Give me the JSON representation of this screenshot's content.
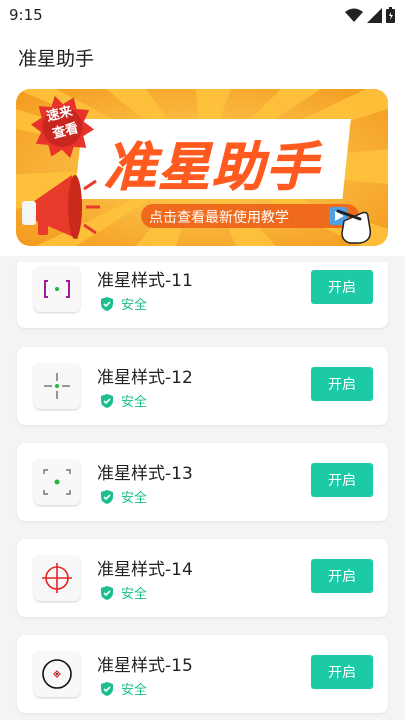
{
  "status_bar": {
    "time": "9:15",
    "icons": [
      "wifi-icon",
      "signal-icon",
      "battery-icon"
    ]
  },
  "header": {
    "title": "准星助手"
  },
  "banner": {
    "badge_line1": "速来",
    "badge_line2": "查看",
    "headline": "准星助手",
    "subtitle": "点击查看最新使用教学",
    "icons": [
      "megaphone-icon",
      "play-icon",
      "pointing-hand-icon"
    ],
    "colors": {
      "background": "#f7b52a",
      "headline": "#ff5a1f",
      "badge": "#e8332b",
      "subtitle_pill": "#f06a1e"
    }
  },
  "styles": [
    {
      "name": "准星样式-11",
      "status": "安全",
      "action": "开启",
      "icon": "crosshair-brackets-icon"
    },
    {
      "name": "准星样式-12",
      "status": "安全",
      "action": "开启",
      "icon": "crosshair-cross-icon"
    },
    {
      "name": "准星样式-13",
      "status": "安全",
      "action": "开启",
      "icon": "crosshair-corners-icon"
    },
    {
      "name": "准星样式-14",
      "status": "安全",
      "action": "开启",
      "icon": "crosshair-target-icon"
    },
    {
      "name": "准星样式-15",
      "status": "安全",
      "action": "开启",
      "icon": "crosshair-scope-icon"
    }
  ],
  "colors": {
    "accent": "#1ccaa6",
    "safe": "#1cbe8e"
  }
}
